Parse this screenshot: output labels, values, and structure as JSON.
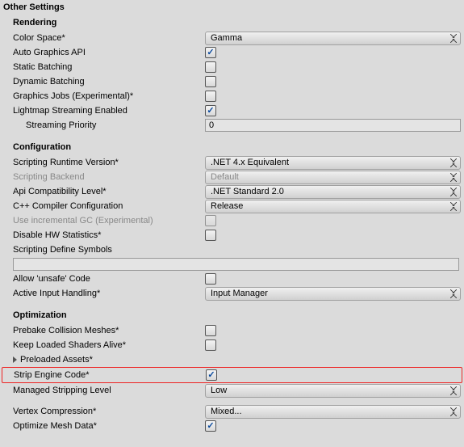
{
  "title": "Other Settings",
  "rendering": {
    "title": "Rendering",
    "colorSpace": {
      "label": "Color Space*",
      "value": "Gamma"
    },
    "autoGraphics": {
      "label": "Auto Graphics API",
      "checked": true
    },
    "staticBatching": {
      "label": "Static Batching",
      "checked": false
    },
    "dynamicBatching": {
      "label": "Dynamic Batching",
      "checked": false
    },
    "graphicsJobs": {
      "label": "Graphics Jobs (Experimental)*",
      "checked": false
    },
    "lightmapStreaming": {
      "label": "Lightmap Streaming Enabled",
      "checked": true
    },
    "streamingPriority": {
      "label": "Streaming Priority",
      "value": "0"
    }
  },
  "configuration": {
    "title": "Configuration",
    "scriptingRuntime": {
      "label": "Scripting Runtime Version*",
      "value": ".NET 4.x Equivalent"
    },
    "scriptingBackend": {
      "label": "Scripting Backend",
      "value": "Default"
    },
    "apiCompat": {
      "label": "Api Compatibility Level*",
      "value": ".NET Standard 2.0"
    },
    "cppCompiler": {
      "label": "C++ Compiler Configuration",
      "value": "Release"
    },
    "incrementalGC": {
      "label": "Use incremental GC (Experimental)",
      "checked": false
    },
    "disableHW": {
      "label": "Disable HW Statistics*",
      "checked": false
    },
    "defineSymbols": {
      "label": "Scripting Define Symbols",
      "value": ""
    },
    "allowUnsafe": {
      "label": "Allow 'unsafe' Code",
      "checked": false
    },
    "activeInput": {
      "label": "Active Input Handling*",
      "value": "Input Manager"
    }
  },
  "optimization": {
    "title": "Optimization",
    "prebakeCollision": {
      "label": "Prebake Collision Meshes*",
      "checked": false
    },
    "keepShaders": {
      "label": "Keep Loaded Shaders Alive*",
      "checked": false
    },
    "preloadedAssets": {
      "label": "Preloaded Assets*"
    },
    "stripEngine": {
      "label": "Strip Engine Code*",
      "checked": true
    },
    "managedStripping": {
      "label": "Managed Stripping Level",
      "value": "Low"
    },
    "vertexCompression": {
      "label": "Vertex Compression*",
      "value": "Mixed..."
    },
    "optimizeMesh": {
      "label": "Optimize Mesh Data*",
      "checked": true
    }
  }
}
